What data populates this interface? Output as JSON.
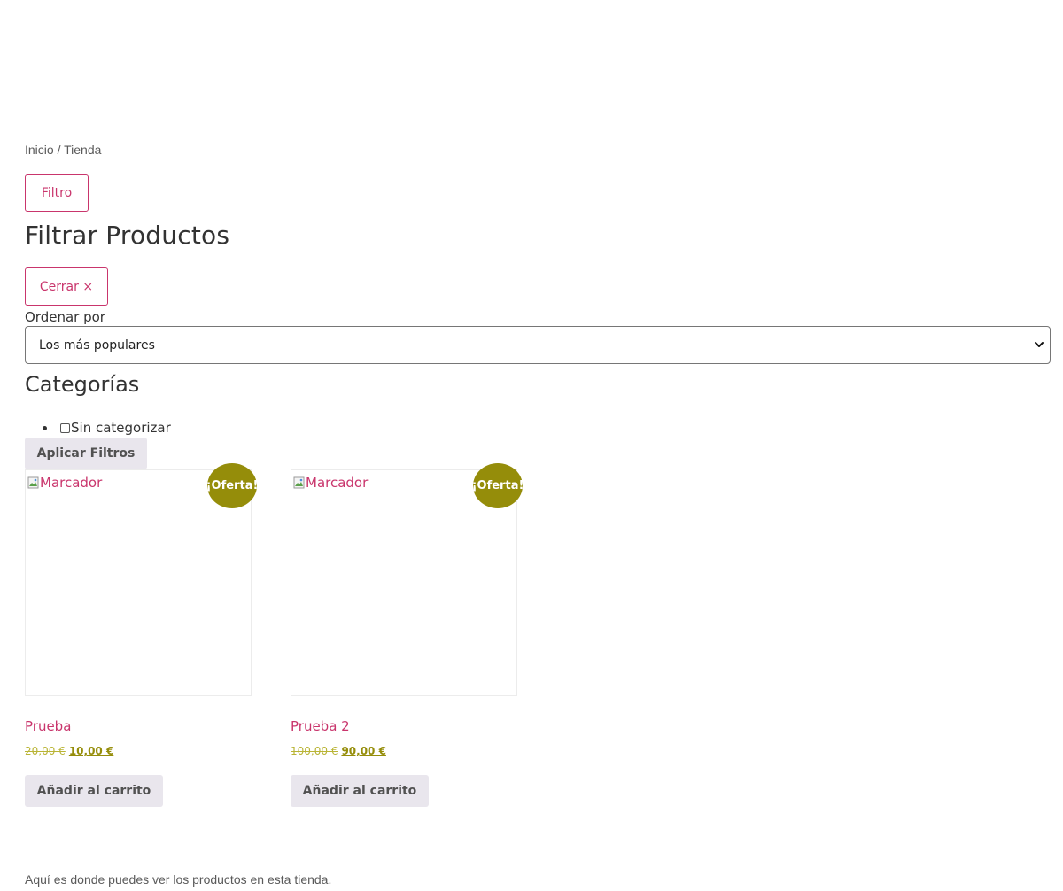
{
  "breadcrumb": "Inicio / Tienda",
  "filter_button": "Filtro",
  "filter_panel": {
    "title": "Filtrar Productos",
    "close_button": "Cerrar ×",
    "sort": {
      "label": "Ordenar por",
      "selected": "Los más populares"
    },
    "categories": {
      "title": "Categorías",
      "items": [
        {
          "label": "Sin categorizar",
          "checked": false
        }
      ]
    },
    "apply_button": "Aplicar Filtros"
  },
  "products": [
    {
      "image_alt": "Marcador",
      "badge": "¡Oferta!",
      "name": "Prueba",
      "old_price": "20,00 €",
      "new_price": "10,00 €",
      "cart_button": "Añadir al carrito"
    },
    {
      "image_alt": "Marcador",
      "badge": "¡Oferta!",
      "name": "Prueba 2",
      "old_price": "100,00 €",
      "new_price": "90,00 €",
      "cart_button": "Añadir al carrito"
    }
  ],
  "footer_text": "Aquí es donde puedes ver los productos en esta tienda.",
  "colors": {
    "accent": "#c9356c",
    "sale_badge": "#958d0a",
    "button_bg": "#e9e6ed",
    "text": "#333333"
  },
  "icons": {
    "sort_select": "chevron-down-icon",
    "product_image": "broken-image-icon"
  }
}
